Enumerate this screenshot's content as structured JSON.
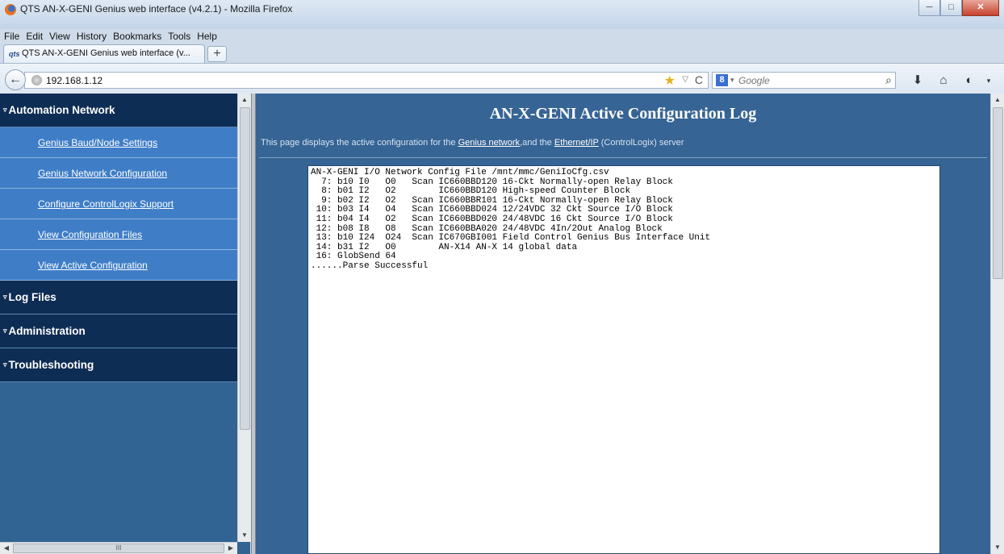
{
  "window": {
    "title": "QTS AN-X-GENI Genius web interface (v4.2.1) - Mozilla Firefox",
    "minimize": "─",
    "maximize": "□",
    "close": "✕"
  },
  "menu": [
    "File",
    "Edit",
    "View",
    "History",
    "Bookmarks",
    "Tools",
    "Help"
  ],
  "tab": {
    "icon_text": "qts",
    "label": "QTS AN-X-GENI Genius web interface (v...",
    "new_tab": "+"
  },
  "nav": {
    "back": "←",
    "url": "192.168.1.12",
    "search_engine": "8",
    "search_placeholder": "Google",
    "icons": {
      "bookmark": "star-icon",
      "reload": "reload-icon",
      "download": "download-icon",
      "home": "home-icon"
    }
  },
  "sidebar": {
    "categories": [
      {
        "label": "Automation Network",
        "items": [
          "Genius Baud/Node Settings",
          "Genius Network Configuration",
          "Configure ControlLogix Support",
          "View Configuration Files",
          "View Active Configuration"
        ]
      },
      {
        "label": "Log Files"
      },
      {
        "label": "Administration"
      },
      {
        "label": "Troubleshooting"
      }
    ],
    "hscroll_grip": "III"
  },
  "main": {
    "title": "AN-X-GENI Active Configuration Log",
    "desc_prefix": "This page displays the active configuration for the ",
    "desc_link1": "Genius network",
    "desc_mid": ",and the ",
    "desc_link2": "Ethernet/IP",
    "desc_suffix": " (ControlLogix) server",
    "log": [
      "AN-X-GENI I/O Network Config File /mnt/mmc/GeniIoCfg.csv",
      "  7: b10 I0   O0   Scan IC660BBD120 16-Ckt Normally-open Relay Block",
      "  8: b01 I2   O2        IC660BBD120 High-speed Counter Block",
      "  9: b02 I2   O2   Scan IC660BBR101 16-Ckt Normally-open Relay Block",
      " 10: b03 I4   O4   Scan IC660BBD024 12/24VDC 32 Ckt Source I/O Block",
      " 11: b04 I4   O2   Scan IC660BBD020 24/48VDC 16 Ckt Source I/O Block",
      " 12: b08 I8   O8   Scan IC660BBA020 24/48VDC 4In/2Out Analog Block",
      " 13: b10 I24  O24  Scan IC670GBI001 Field Control Genius Bus Interface Unit",
      " 14: b31 I2   O0        AN-X14 AN-X 14 global data",
      " 16: GlobSend 64",
      "......Parse Successful"
    ]
  }
}
